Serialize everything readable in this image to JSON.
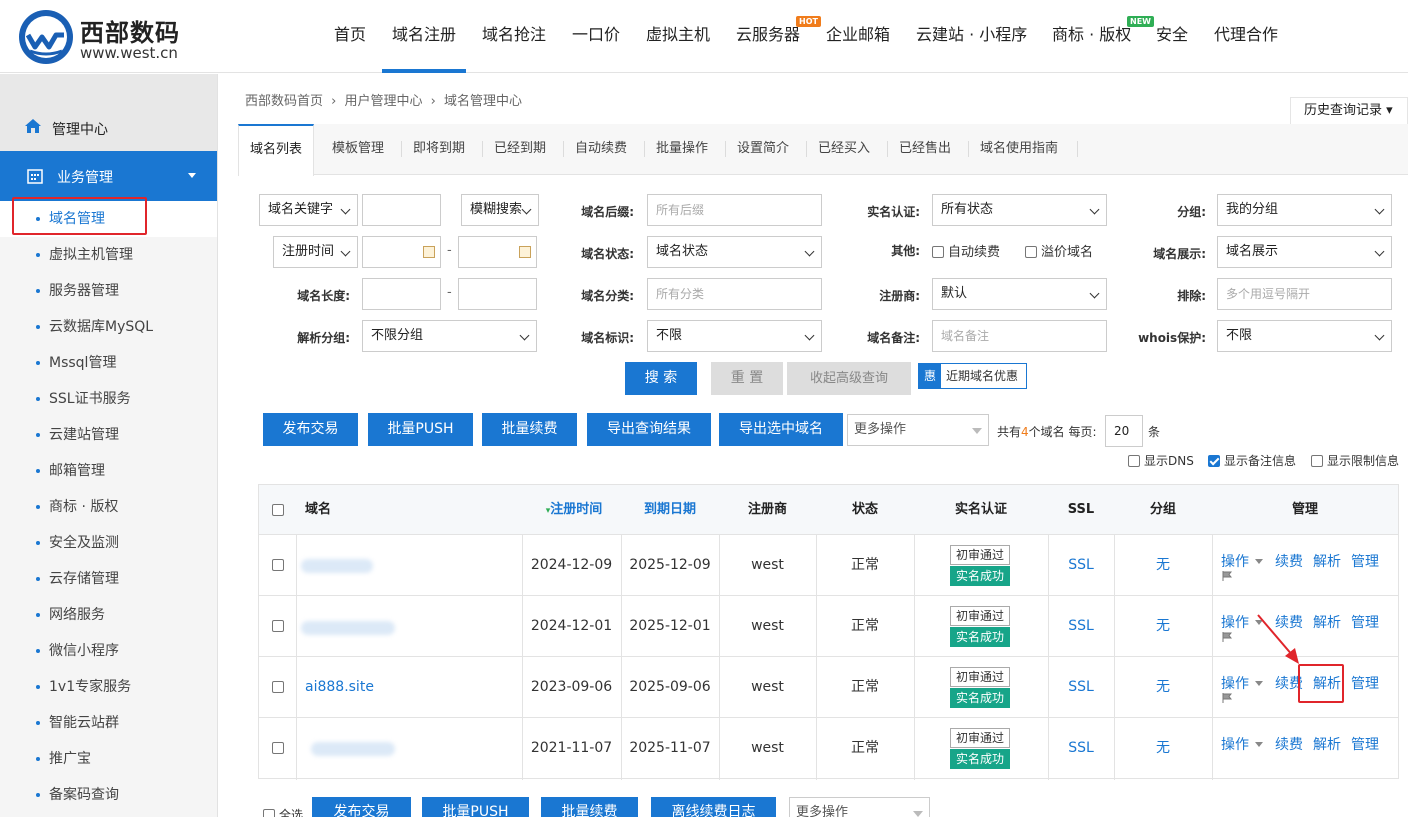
{
  "header": {
    "logo_cn": "西部数码",
    "logo_en": "www.west.cn",
    "nav": [
      "首页",
      "域名注册",
      "域名抢注",
      "一口价",
      "虚拟主机",
      "云服务器",
      "企业邮箱",
      "云建站 · 小程序",
      "商标 · 版权",
      "安全",
      "代理合作"
    ],
    "hot_badge": "HOT",
    "new_badge": "NEW",
    "colors": {
      "primary": "#1a77d2",
      "hot": "#f07c1b",
      "new": "#2fae55",
      "highlight": "#e0252b"
    }
  },
  "sidebar": {
    "home": "管理中心",
    "section": "业务管理",
    "items": [
      "域名管理",
      "虚拟主机管理",
      "服务器管理",
      "云数据库MySQL",
      "Mssql管理",
      "SSL证书服务",
      "云建站管理",
      "邮箱管理",
      "商标 · 版权",
      "安全及监测",
      "云存储管理",
      "网络服务",
      "微信小程序",
      "1v1专家服务",
      "智能云站群",
      "推广宝",
      "备案码查询"
    ]
  },
  "breadcrumb": [
    "西部数码首页",
    "›",
    "用户管理中心",
    "›",
    "域名管理中心"
  ],
  "history_btn": "历史查询记录 ▾",
  "tabs": [
    "域名列表",
    "模板管理",
    "即将到期",
    "已经到期",
    "自动续费",
    "批量操作",
    "设置简介",
    "已经买入",
    "已经售出",
    "域名使用指南"
  ],
  "filters": {
    "keyword_type": "域名关键字",
    "match_mode": "模糊搜索",
    "suffix_label": "域名后缀:",
    "suffix_placeholder": "所有后缀",
    "realname_label": "实名认证:",
    "realname_value": "所有状态",
    "group_label": "分组:",
    "group_value": "我的分组",
    "regtime_type": "注册时间",
    "dash": "-",
    "status_label": "域名状态:",
    "status_value": "域名状态",
    "other_label": "其他:",
    "auto_renew": "自动续费",
    "premium": "溢价域名",
    "display_label": "域名展示:",
    "display_value": "域名展示",
    "length_label": "域名长度:",
    "category_label": "域名分类:",
    "category_placeholder": "所有分类",
    "registrar_label": "注册商:",
    "registrar_value": "默认",
    "exclude_label": "排除:",
    "exclude_placeholder": "多个用逗号隔开",
    "dns_group_label": "解析分组:",
    "dns_group_value": "不限分组",
    "flag_label": "域名标识:",
    "flag_value": "不限",
    "remark_label": "域名备注:",
    "remark_placeholder": "域名备注",
    "whois_label": "whois保护:",
    "whois_value": "不限"
  },
  "actions": {
    "search": "搜 索",
    "reset": "重 置",
    "collapse": "收起高级查询",
    "promo_icon": "惠",
    "promo": "近期域名优惠",
    "publish": "发布交易",
    "push": "批量PUSH",
    "renew": "批量续费",
    "export_result": "导出查询结果",
    "export_selected": "导出选中域名",
    "more": "更多操作",
    "total_pre": "共有",
    "total_count": "4",
    "total_post": "个域名 每页:",
    "per_page": "20",
    "per_page_unit": "条",
    "show_dns": "显示DNS",
    "show_remark": "显示备注信息",
    "show_limit": "显示限制信息",
    "offline_log": "离线续费日志",
    "select_all": "全选"
  },
  "table": {
    "headers": [
      "域名",
      "注册时间",
      "到期日期",
      "注册商",
      "状态",
      "实名认证",
      "SSL",
      "分组",
      "管理"
    ],
    "sort_icon": "▾",
    "rows": [
      {
        "domain": "",
        "reg": "2024-12-09",
        "exp": "2025-12-09",
        "registrar": "west",
        "status": "正常",
        "audit": "初审通过",
        "realname": "实名成功",
        "ssl": "SSL",
        "group": "无"
      },
      {
        "domain": "",
        "reg": "2024-12-01",
        "exp": "2025-12-01",
        "registrar": "west",
        "status": "正常",
        "audit": "初审通过",
        "realname": "实名成功",
        "ssl": "SSL",
        "group": "无"
      },
      {
        "domain": "ai888.site",
        "reg": "2023-09-06",
        "exp": "2025-09-06",
        "registrar": "west",
        "status": "正常",
        "audit": "初审通过",
        "realname": "实名成功",
        "ssl": "SSL",
        "group": "无"
      },
      {
        "domain": "",
        "reg": "2021-11-07",
        "exp": "2025-11-07",
        "registrar": "west",
        "status": "正常",
        "audit": "初审通过",
        "realname": "实名成功",
        "ssl": "SSL",
        "group": "无"
      }
    ],
    "ops": {
      "operate": "操作",
      "renew": "续费",
      "dns": "解析",
      "manage": "管理"
    }
  }
}
